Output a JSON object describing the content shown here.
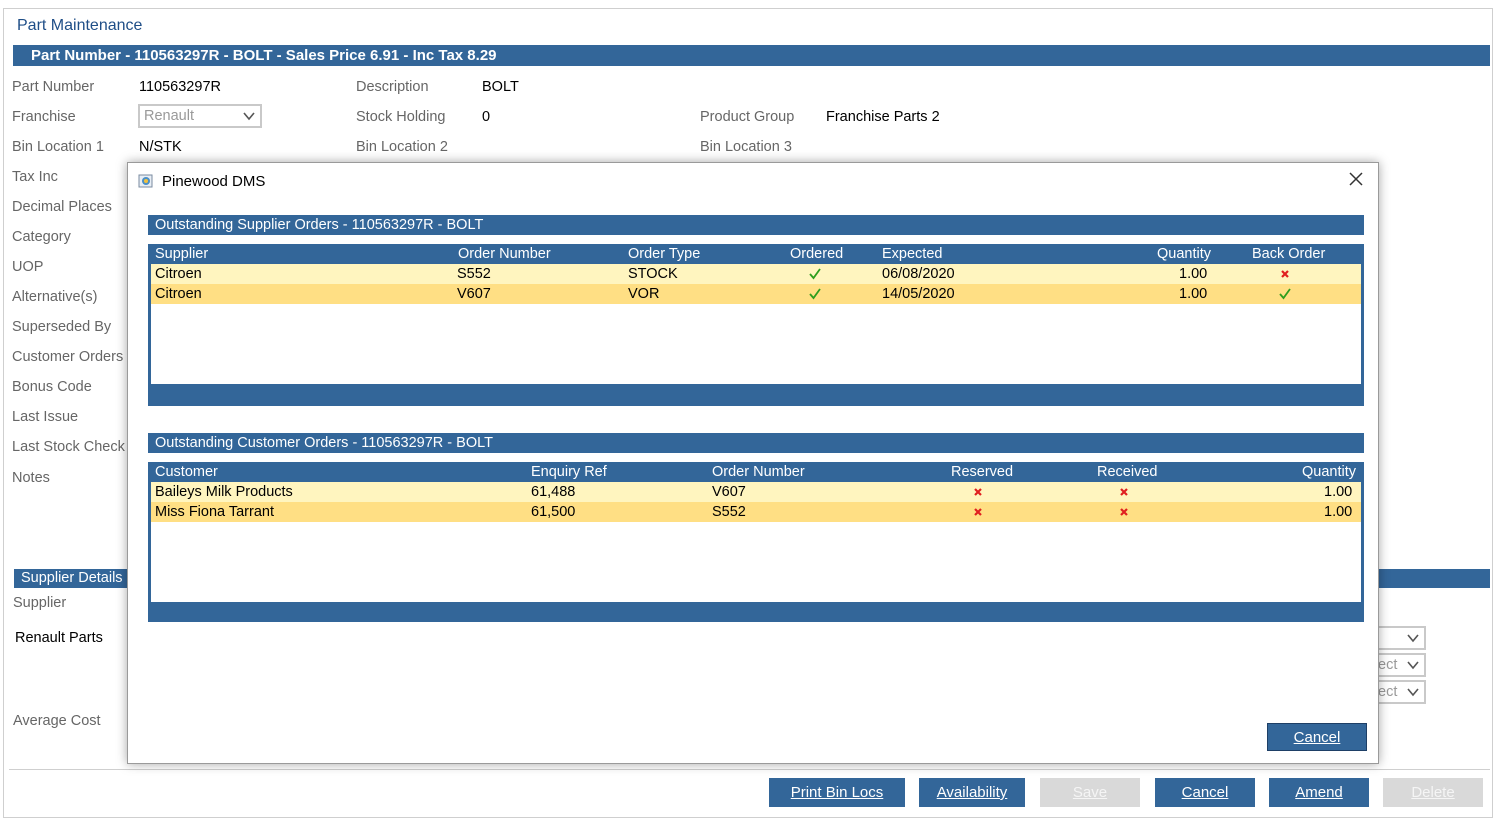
{
  "page": {
    "title": "Part Maintenance",
    "header_bar": "Part Number - 110563297R - BOLT - Sales Price 6.91 - Inc Tax 8.29"
  },
  "form": {
    "part_number_label": "Part Number",
    "part_number_value": "110563297R",
    "description_label": "Description",
    "description_value": "BOLT",
    "franchise_label": "Franchise",
    "franchise_value": "Renault",
    "stock_holding_label": "Stock Holding",
    "stock_holding_value": "0",
    "product_group_label": "Product Group",
    "product_group_value": "Franchise Parts 2",
    "bin1_label": "Bin Location 1",
    "bin1_value": "N/STK",
    "bin2_label": "Bin Location 2",
    "bin3_label": "Bin Location 3",
    "side_labels": [
      "Tax Inc",
      "Decimal Places",
      "Category",
      "UOP",
      "Alternative(s)",
      "Superseded By",
      "Customer Orders",
      "Bonus Code",
      "Last Issue",
      "Last Stock Check",
      "Notes"
    ]
  },
  "supplier_section": {
    "bar_label": "Supplier Details",
    "supplier_label": "Supplier",
    "supplier_value": "Renault Parts",
    "avg_cost_label": "Average Cost",
    "select_partial_1": "ect",
    "select_partial_2": "ect"
  },
  "buttons": {
    "print_bin_locs": "Print Bin Locs",
    "availability": "Availability",
    "save": "Save",
    "cancel": "Cancel",
    "amend": "Amend",
    "delete": "Delete"
  },
  "modal": {
    "title": "Pinewood DMS",
    "supplier_orders": {
      "title": "Outstanding Supplier Orders -  110563297R -  BOLT",
      "columns": [
        "Supplier",
        "Order Number",
        "Order Type",
        "Ordered",
        "Expected",
        "Quantity",
        "Back Order"
      ],
      "rows": [
        {
          "supplier": "Citroen",
          "order_number": "S552",
          "order_type": "STOCK",
          "ordered": true,
          "expected": "06/08/2020",
          "quantity": "1.00",
          "back_order": false
        },
        {
          "supplier": "Citroen",
          "order_number": "V607",
          "order_type": "VOR",
          "ordered": true,
          "expected": "14/05/2020",
          "quantity": "1.00",
          "back_order": true
        }
      ]
    },
    "customer_orders": {
      "title": "Outstanding Customer Orders -  110563297R -  BOLT",
      "columns": [
        "Customer",
        "Enquiry Ref",
        "Order Number",
        "Reserved",
        "Received",
        "Quantity"
      ],
      "rows": [
        {
          "customer": "Baileys Milk Products",
          "enquiry_ref": "61,488",
          "order_number": "V607",
          "reserved": false,
          "received": false,
          "quantity": "1.00"
        },
        {
          "customer": "Miss Fiona Tarrant",
          "enquiry_ref": "61,500",
          "order_number": "S552",
          "reserved": false,
          "received": false,
          "quantity": "1.00"
        }
      ]
    },
    "cancel_label": "Cancel"
  },
  "colors": {
    "accent": "#336699",
    "row_odd": "#fff5bf",
    "row_even": "#ffdf84",
    "check": "#2e9e1e",
    "cross": "#e02020"
  }
}
